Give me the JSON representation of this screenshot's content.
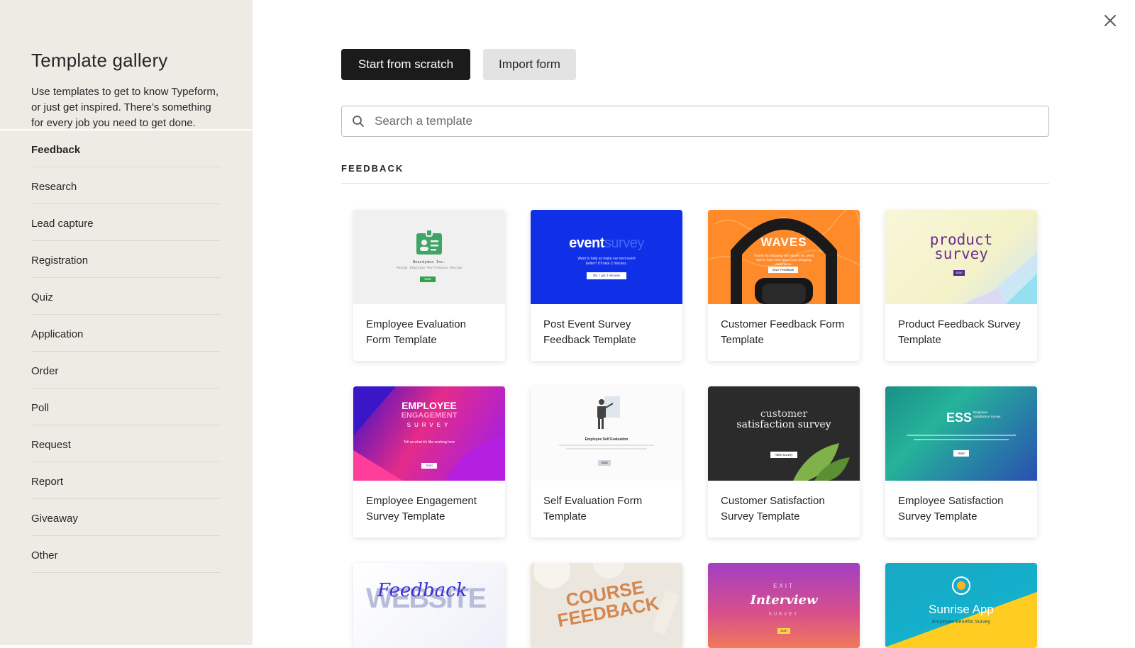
{
  "sidebar": {
    "title": "Template gallery",
    "description": "Use templates to get to know Typeform, or just get inspired. There’s something for every job you need to get done.",
    "categories": [
      {
        "label": "Feedback",
        "active": true
      },
      {
        "label": "Research"
      },
      {
        "label": "Lead capture"
      },
      {
        "label": "Registration"
      },
      {
        "label": "Quiz"
      },
      {
        "label": "Application"
      },
      {
        "label": "Order"
      },
      {
        "label": "Poll"
      },
      {
        "label": "Request"
      },
      {
        "label": "Report"
      },
      {
        "label": "Giveaway"
      },
      {
        "label": "Other"
      }
    ]
  },
  "header": {
    "start_label": "Start from scratch",
    "import_label": "Import form",
    "close_icon": "close-icon"
  },
  "search": {
    "placeholder": "Search a template",
    "value": "",
    "icon": "search-icon"
  },
  "section": {
    "title": "FEEDBACK"
  },
  "thumbs": {
    "t1": {
      "company": "Beacdymon Inc.",
      "sub": "Annual Employee Performance Review",
      "btn": "Start"
    },
    "t2": {
      "word1": "event",
      "word2": "survey",
      "sub": "Want to help us make our next event better? It'll take 2 minutes.",
      "btn": "OK, I got 2 minutes"
    },
    "t3": {
      "brand": "WAVES",
      "sub": "Thanks for shopping with Waves Inc. We'd love to hear more about your shopping experience.",
      "btn": "Give Feedback"
    },
    "t4": {
      "word1": "product",
      "word2": "survey",
      "btn": "Start"
    },
    "t5": {
      "line1": "EMPLOYEE",
      "line2": "ENGAGEMENT",
      "line3": "SURVEY",
      "sub": "Tell us what it's like working here",
      "btn": "Start"
    },
    "t6": {
      "title": "Employee Self Evaluation",
      "btn": "Start"
    },
    "t7": {
      "line1": "customer",
      "line2": "satisfaction survey",
      "btn": "Take Survey"
    },
    "t8": {
      "brand": "ESS",
      "small": "Employee Satisfaction Survey",
      "btn": "Start"
    },
    "t9": {
      "word1": "WEBSITE",
      "word2": "Feedback"
    },
    "t10": {
      "word1": "COURSE",
      "word2": "FEEDBACK"
    },
    "t11": {
      "top": "EXIT",
      "main": "Interview",
      "bottom": "SURVEY",
      "btn": "Start"
    },
    "t12": {
      "title": "Sunrise App",
      "sub": "Employee Benefits Survey"
    }
  },
  "templates": [
    {
      "label": "Employee Evaluation Form Template"
    },
    {
      "label": "Post Event Survey Feedback Template"
    },
    {
      "label": "Customer Feedback Form Template"
    },
    {
      "label": "Product Feedback Survey Template"
    },
    {
      "label": "Employee Engagement Survey Template"
    },
    {
      "label": "Self Evaluation Form Template"
    },
    {
      "label": "Customer Satisfaction Survey Template"
    },
    {
      "label": "Employee Satisfaction Survey Template"
    }
  ],
  "colors": {
    "sidebar_bg": "#eeebe5",
    "primary_button": "#1b1b1b",
    "secondary_button": "#e3e3e3"
  }
}
